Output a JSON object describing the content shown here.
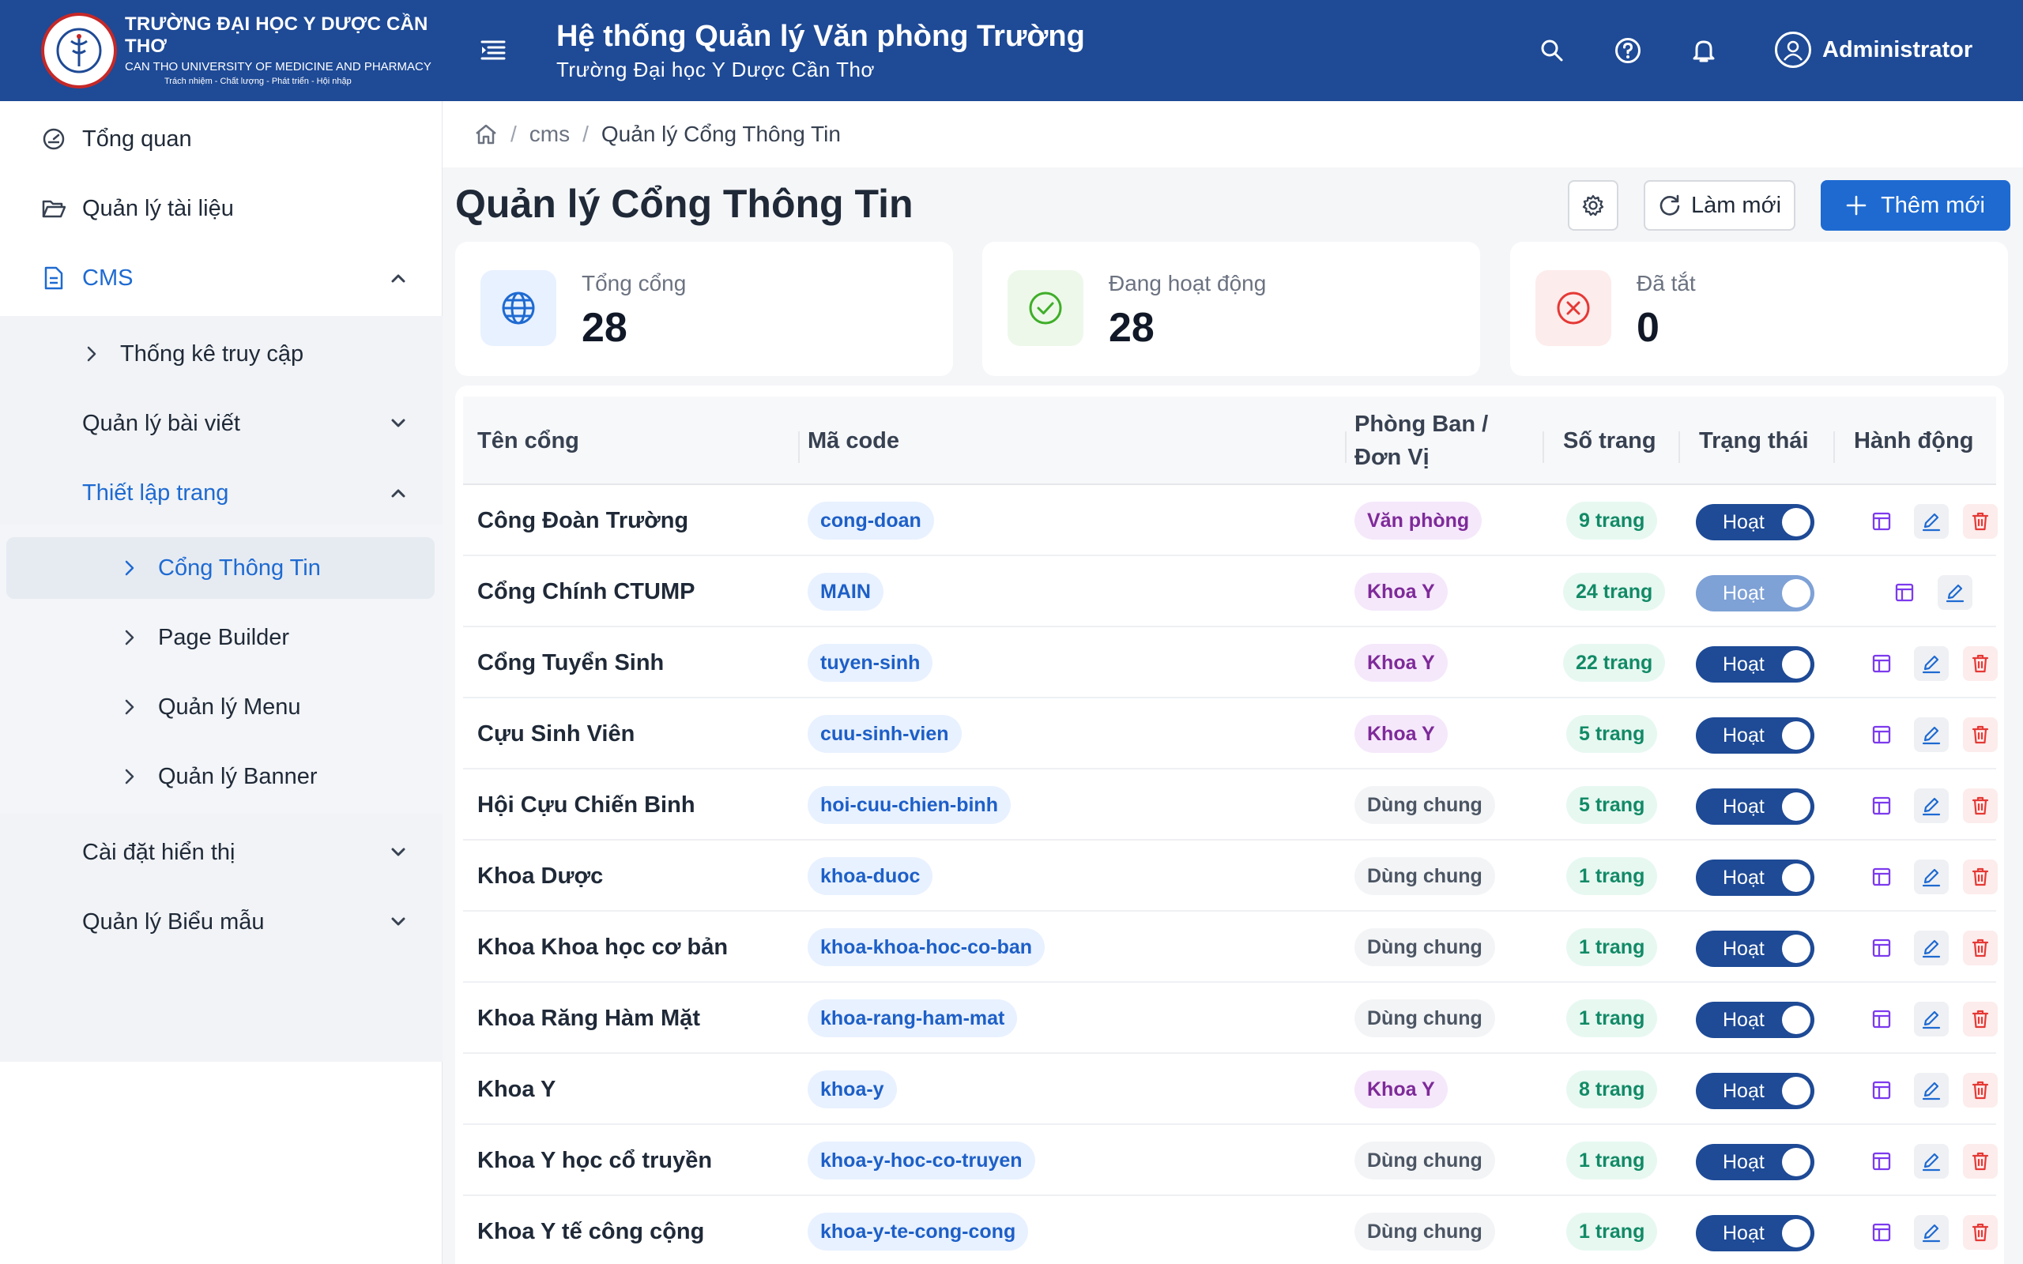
{
  "header": {
    "logo_name": "TRƯỜNG ĐẠI HỌC Y DƯỢC CẦN THƠ",
    "logo_en": "CAN THO UNIVERSITY OF MEDICINE AND PHARMACY",
    "logo_motto": "Trách nhiệm - Chất lượng - Phát triển - Hội nhập",
    "app_title": "Hệ thống Quản lý Văn phòng Trường",
    "app_subtitle": "Trường Đại học Y Dược Cần Thơ",
    "user_name": "Administrator",
    "brand_color": "#1e4a96"
  },
  "sidebar": {
    "dashboard": "Tổng quan",
    "documents": "Quản lý tài liệu",
    "cms": "CMS",
    "stats": "Thống kê truy cập",
    "posts": "Quản lý bài viết",
    "page_setup": "Thiết lập trang",
    "portal": "Cổng Thông Tin",
    "page_builder": "Page Builder",
    "menu": "Quản lý Menu",
    "banner": "Quản lý Banner",
    "display": "Cài đặt hiển thị",
    "forms": "Quản lý Biểu mẫu"
  },
  "breadcrumb": {
    "level1": "cms",
    "current": "Quản lý Cổng Thông Tin"
  },
  "page": {
    "title": "Quản lý Cổng Thông Tin",
    "refresh_label": "Làm mới",
    "add_label": "Thêm mới",
    "accent_color": "#1e6ad1"
  },
  "stats": [
    {
      "label": "Tổng cổng",
      "value": "28",
      "icon": "globe-icon"
    },
    {
      "label": "Đang hoạt động",
      "value": "28",
      "icon": "check-circle-icon"
    },
    {
      "label": "Đã tắt",
      "value": "0",
      "icon": "x-circle-icon"
    }
  ],
  "table": {
    "headers": {
      "name": "Tên cổng",
      "code": "Mã code",
      "dept_line1": "Phòng Ban /",
      "dept_line2": "Đơn Vị",
      "pages": "Số trang",
      "status": "Trạng thái",
      "actions": "Hành động"
    },
    "rows": [
      {
        "name": "Công Đoàn Trường",
        "code": "cong-doan",
        "dept": "Văn phòng",
        "pages": "9 trang",
        "status": "Hoạt",
        "deletable": true
      },
      {
        "name": "Cổng Chính CTUMP",
        "code": "MAIN",
        "dept": "Khoa Y",
        "pages": "24 trang",
        "status": "Hoạt",
        "deletable": false
      },
      {
        "name": "Cổng Tuyển Sinh",
        "code": "tuyen-sinh",
        "dept": "Khoa Y",
        "pages": "22 trang",
        "status": "Hoạt",
        "deletable": true
      },
      {
        "name": "Cựu Sinh Viên",
        "code": "cuu-sinh-vien",
        "dept": "Khoa Y",
        "pages": "5 trang",
        "status": "Hoạt",
        "deletable": true
      },
      {
        "name": "Hội Cựu Chiến Binh",
        "code": "hoi-cuu-chien-binh",
        "dept": "Dùng chung",
        "pages": "5 trang",
        "status": "Hoạt",
        "deletable": true
      },
      {
        "name": "Khoa Dược",
        "code": "khoa-duoc",
        "dept": "Dùng chung",
        "pages": "1 trang",
        "status": "Hoạt",
        "deletable": true
      },
      {
        "name": "Khoa Khoa học cơ bản",
        "code": "khoa-khoa-hoc-co-ban",
        "dept": "Dùng chung",
        "pages": "1 trang",
        "status": "Hoạt",
        "deletable": true
      },
      {
        "name": "Khoa Răng Hàm Mặt",
        "code": "khoa-rang-ham-mat",
        "dept": "Dùng chung",
        "pages": "1 trang",
        "status": "Hoạt",
        "deletable": true
      },
      {
        "name": "Khoa Y",
        "code": "khoa-y",
        "dept": "Khoa Y",
        "pages": "8 trang",
        "status": "Hoạt",
        "deletable": true
      },
      {
        "name": "Khoa Y học cổ truyền",
        "code": "khoa-y-hoc-co-truyen",
        "dept": "Dùng chung",
        "pages": "1 trang",
        "status": "Hoạt",
        "deletable": true
      },
      {
        "name": "Khoa Y tế công cộng",
        "code": "khoa-y-te-cong-cong",
        "dept": "Dùng chung",
        "pages": "1 trang",
        "status": "Hoạt",
        "deletable": true
      }
    ]
  }
}
